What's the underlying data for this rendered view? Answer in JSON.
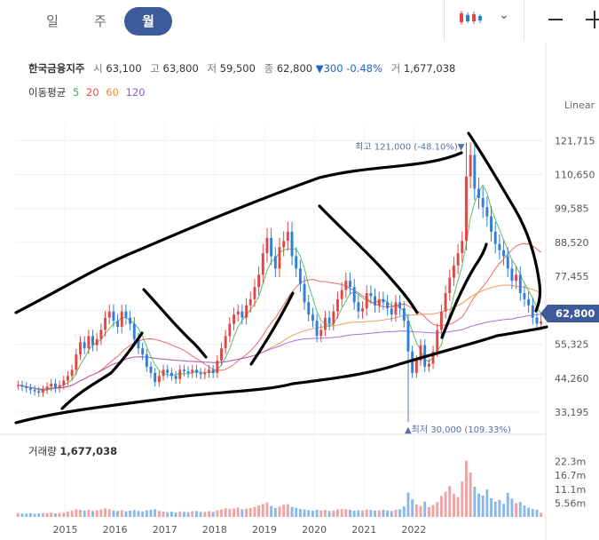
{
  "periods": {
    "day": "일",
    "week": "주",
    "month": "월",
    "active": "month"
  },
  "toolbar": {
    "chart_type_icon": "candlestick-icon",
    "dropdown_icon": "chevron-down-icon",
    "minimize_icon": "minus-icon",
    "crosshair_icon": "crosshair-icon"
  },
  "quote": {
    "name": "한국금융지주",
    "open_label": "시",
    "open": "63,100",
    "high_label": "고",
    "high": "63,800",
    "low_label": "저",
    "low": "59,500",
    "close_label": "종",
    "close": "62,800",
    "change": "▼300 -0.48%",
    "volume_label": "거",
    "volume": "1,677,038"
  },
  "moving_average": {
    "label": "이동평균",
    "periods": [
      "5",
      "20",
      "60",
      "120"
    ],
    "colors": [
      "#3fb34f",
      "#e8504a",
      "#f08a3c",
      "#9a55d6"
    ]
  },
  "scale_mode": "Linear",
  "price_badge": "62,800",
  "volume_title": {
    "label": "거래량",
    "value": "1,677,038"
  },
  "colors": {
    "up": "#e04848",
    "down": "#2f7ed8",
    "accent": "#3d5a99",
    "volume_up": "#f0a3a3",
    "volume_down": "#8bb8ea"
  },
  "chart_data": [
    {
      "type": "candlestick",
      "interval": "monthly",
      "y_scale": "linear",
      "ylim": [
        28000,
        127000
      ],
      "y_ticks": [
        "121,715",
        "110,650",
        "99,585",
        "88,520",
        "77,455",
        "66,390",
        "55,325",
        "44,260",
        "33,195"
      ],
      "y_tick_values": [
        121715,
        110650,
        99585,
        88520,
        77455,
        66390,
        55325,
        44260,
        33195
      ],
      "x_ticks": [
        "2015",
        "2016",
        "2017",
        "2018",
        "2019",
        "2020",
        "2021",
        "2022"
      ],
      "x_range": [
        "2014-01",
        "2022-08"
      ],
      "max_annotation": "최고 121,000 (-48.10%)▼",
      "min_annotation": "▲최저 30,000 (109.33%)",
      "last_close": 62800,
      "closes": [
        42000,
        41500,
        41000,
        40500,
        40000,
        39500,
        40500,
        41500,
        42500,
        41000,
        42000,
        43500,
        45000,
        47000,
        52000,
        56000,
        54000,
        58000,
        55000,
        57000,
        60000,
        64000,
        66000,
        63000,
        61000,
        66000,
        64000,
        62000,
        57000,
        54000,
        52000,
        48000,
        46000,
        43000,
        45000,
        47000,
        46000,
        45000,
        44000,
        47000,
        46500,
        46000,
        47000,
        46000,
        45500,
        46000,
        47000,
        46000,
        50000,
        54000,
        58000,
        62000,
        65000,
        66000,
        64000,
        68000,
        70000,
        74000,
        78000,
        85000,
        90000,
        84000,
        80000,
        87000,
        89000,
        92000,
        84000,
        80000,
        75000,
        69000,
        65000,
        63000,
        58000,
        60000,
        64000,
        62000,
        66000,
        70000,
        73000,
        76000,
        74000,
        69000,
        66000,
        67000,
        72000,
        71000,
        68000,
        70000,
        69000,
        67000,
        65000,
        69000,
        67000,
        63000,
        53000,
        46000,
        50000,
        55000,
        48000,
        49000,
        53000,
        60000,
        66000,
        72000,
        77000,
        81000,
        85000,
        89000,
        110000,
        117000,
        106000,
        103000,
        100000,
        97000,
        92000,
        88000,
        86000,
        84000,
        80000,
        76000,
        78000,
        72000,
        70000,
        68000,
        64000,
        62000,
        62800
      ]
    },
    {
      "type": "bar",
      "name": "거래량",
      "interval": "monthly",
      "y_ticks": [
        "22.3m",
        "16.7m",
        "11.1m",
        "5.56m"
      ],
      "y_tick_values": [
        22.3,
        16.7,
        11.1,
        5.56
      ],
      "ylim": [
        0,
        27.5
      ],
      "unit": "m",
      "last_value": 1.677038,
      "values": [
        1.6,
        1.4,
        1.3,
        1.5,
        1.2,
        1.4,
        1.6,
        1.5,
        1.8,
        1.4,
        1.6,
        1.8,
        2.2,
        2.6,
        3.1,
        2.8,
        2.6,
        2.9,
        2.4,
        2.7,
        3.0,
        3.4,
        3.1,
        2.6,
        2.4,
        2.7,
        2.3,
        2.5,
        2.8,
        2.4,
        2.2,
        2.6,
        2.9,
        3.1,
        2.4,
        2.1,
        1.9,
        2.1,
        1.8,
        2.2,
        2.0,
        1.9,
        2.3,
        2.4,
        2.0,
        2.1,
        2.3,
        2.0,
        2.6,
        3.0,
        3.5,
        3.2,
        3.4,
        3.8,
        3.1,
        3.3,
        3.6,
        4.0,
        4.6,
        5.2,
        5.8,
        4.4,
        3.6,
        4.2,
        4.9,
        5.1,
        4.0,
        3.7,
        3.2,
        3.0,
        2.7,
        2.5,
        2.9,
        2.6,
        2.8,
        2.4,
        2.6,
        3.0,
        3.2,
        3.1,
        2.9,
        2.5,
        2.7,
        2.6,
        3.0,
        2.8,
        2.5,
        2.7,
        2.9,
        2.6,
        2.4,
        2.8,
        3.1,
        4.2,
        9.8,
        7.1,
        5.0,
        4.3,
        6.2,
        4.0,
        4.8,
        5.9,
        8.4,
        10.1,
        12.4,
        9.2,
        8.0,
        14.2,
        22.6,
        17.9,
        12.2,
        9.4,
        8.6,
        11.0,
        7.5,
        6.1,
        6.8,
        5.3,
        9.7,
        7.4,
        5.5,
        6.0,
        4.6,
        3.7,
        3.2,
        2.9,
        1.7
      ]
    }
  ]
}
